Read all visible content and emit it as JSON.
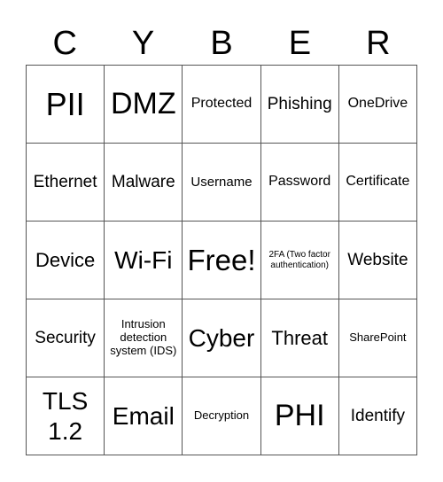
{
  "title_letters": [
    "C",
    "Y",
    "B",
    "E",
    "R"
  ],
  "cells": [
    [
      "PII",
      "DMZ",
      "Protected",
      "Phishing",
      "OneDrive"
    ],
    [
      "Ethernet",
      "Malware",
      "Username",
      "Password",
      "Certificate"
    ],
    [
      "Device",
      "Wi-Fi",
      "Free!",
      "2FA (Two factor authentication)",
      "Website"
    ],
    [
      "Security",
      "Intrusion detection system (IDS)",
      "Cyber",
      "Threat",
      "SharePoint"
    ],
    [
      "TLS 1.2",
      "Email",
      "Decryption",
      "PHI",
      "Identify"
    ]
  ]
}
